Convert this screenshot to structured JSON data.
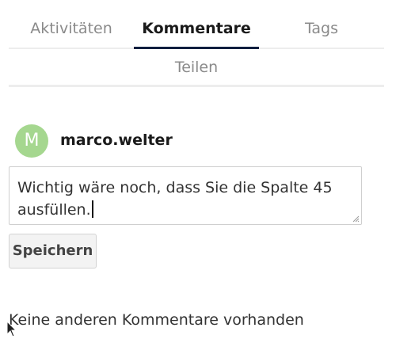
{
  "tabs": {
    "aktivitaeten": "Aktivitäten",
    "kommentare": "Kommentare",
    "tags": "Tags",
    "teilen": "Teilen",
    "active": "kommentare"
  },
  "user": {
    "avatar_letter": "M",
    "avatar_color": "#a5d78f",
    "name": "marco.welter"
  },
  "comment": {
    "value": "Wichtig wäre noch, dass Sie die Spalte 45 ausfüllen."
  },
  "buttons": {
    "save_label": "Speichern"
  },
  "empty_message": "Keine anderen Kommentare vorhanden",
  "colors": {
    "active_tab_underline": "#0b1f3f"
  }
}
